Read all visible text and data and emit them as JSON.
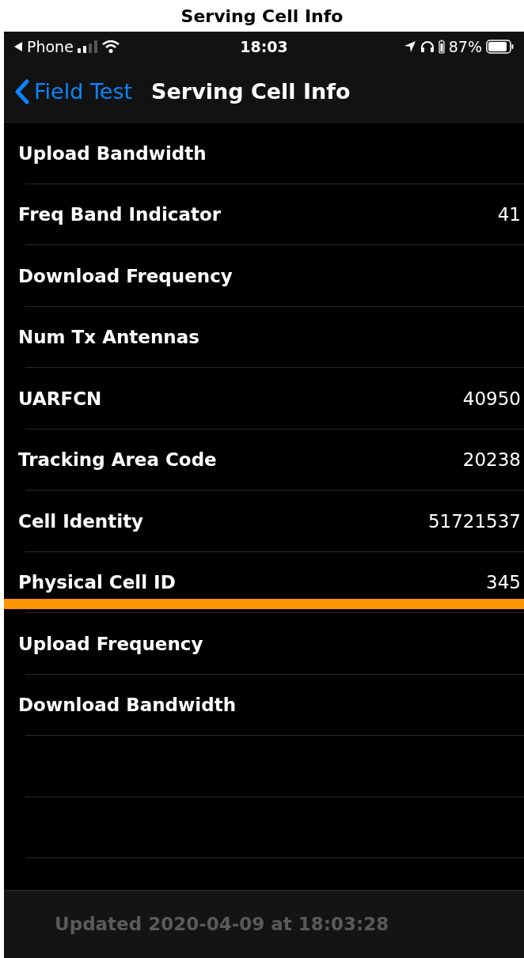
{
  "caption": "Serving Cell Info",
  "status_bar": {
    "back_app": "Phone",
    "time": "18:03",
    "battery": "87%"
  },
  "nav": {
    "back": "Field Test",
    "title": "Serving Cell Info"
  },
  "rows": [
    {
      "label": "Upload Bandwidth",
      "highlighted": false
    },
    {
      "label": "Freq Band Indicator",
      "value": "41",
      "highlighted": false
    },
    {
      "label": "Download Frequency",
      "highlighted": false
    },
    {
      "label": "Num Tx Antennas",
      "highlighted": false
    },
    {
      "label": "UARFCN",
      "value": "40950",
      "highlighted": false
    },
    {
      "label": "Tracking Area Code",
      "value": "20238",
      "highlighted": false
    },
    {
      "label": "Cell Identity",
      "value": "51721537",
      "highlighted": false
    },
    {
      "label": "Physical Cell ID",
      "value": "345",
      "highlighted": true
    },
    {
      "label": "Upload Frequency",
      "highlighted": false
    },
    {
      "label": "Download Bandwidth",
      "highlighted": false
    }
  ],
  "footer": "Updated 2020-04-09 at 18:03:28"
}
